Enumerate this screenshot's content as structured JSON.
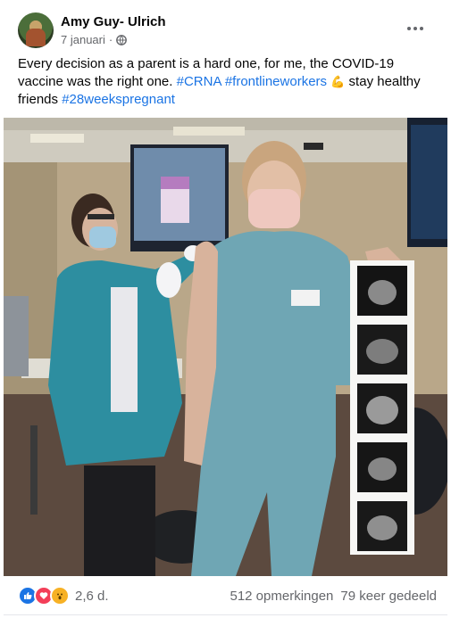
{
  "post": {
    "author": "Amy Guy- Ulrich",
    "date": "7 januari",
    "date_separator": "·",
    "text_prefix": "Every decision as a parent is a hard one, for me, the COVID-19 vaccine was the right one. ",
    "hashtag_1": "#CRNA",
    "hashtag_2": "#frontlineworkers",
    "text_middle": " stay healthy friends ",
    "hashtag_3": "#28weekspregnant",
    "emoji": "💪"
  },
  "stats": {
    "reaction_count": "2,6 d.",
    "comments": "512 opmerkingen",
    "shares": "79 keer gedeeld"
  },
  "colors": {
    "link": "#1b74e4",
    "secondary_text": "#65676b",
    "scrubs": "#6fa6b4",
    "jacket": "#2d8ea0"
  }
}
